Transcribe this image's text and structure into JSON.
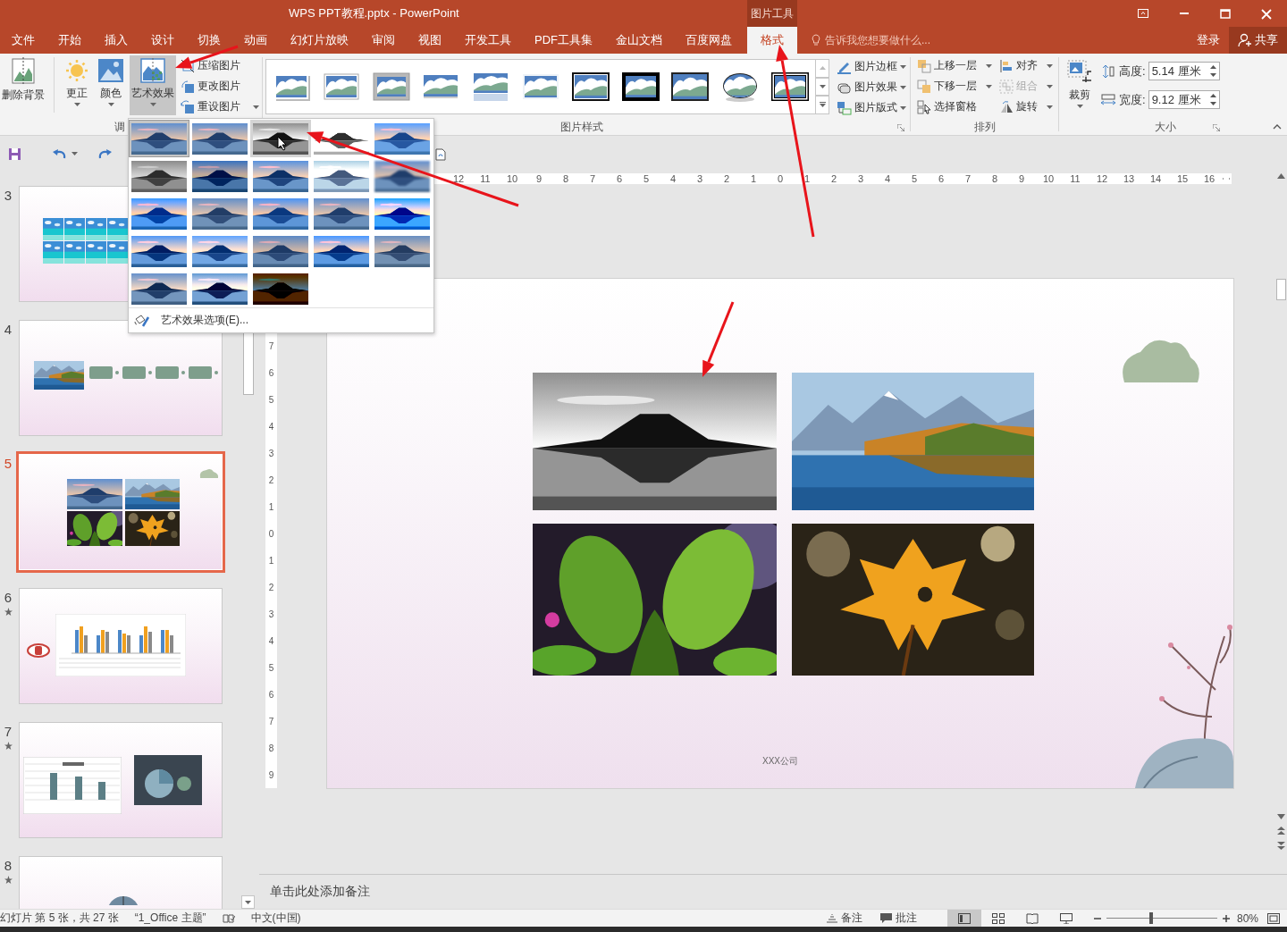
{
  "window": {
    "title": "WPS PPT教程.pptx - PowerPoint",
    "context_tab": "图片工具"
  },
  "menu_tabs": [
    {
      "label": "文件",
      "selected": false
    },
    {
      "label": "开始",
      "selected": false
    },
    {
      "label": "插入",
      "selected": false
    },
    {
      "label": "设计",
      "selected": false
    },
    {
      "label": "切换",
      "selected": false
    },
    {
      "label": "动画",
      "selected": false
    },
    {
      "label": "幻灯片放映",
      "selected": false
    },
    {
      "label": "审阅",
      "selected": false
    },
    {
      "label": "视图",
      "selected": false
    },
    {
      "label": "开发工具",
      "selected": false
    },
    {
      "label": "PDF工具集",
      "selected": false
    },
    {
      "label": "金山文档",
      "selected": false
    },
    {
      "label": "百度网盘",
      "selected": false
    },
    {
      "label": "格式",
      "selected": true
    }
  ],
  "tell_me": {
    "placeholder": "告诉我您想要做什么..."
  },
  "account": {
    "sign_in": "登录",
    "share": "共享"
  },
  "ribbon": {
    "adjust": {
      "remove_background": "删除背景",
      "buttons": [
        {
          "label": "更正",
          "selected": false,
          "kind": "corrections"
        },
        {
          "label": "颜色",
          "selected": false,
          "kind": "color"
        },
        {
          "label": "艺术效果",
          "selected": true,
          "kind": "artistic"
        }
      ],
      "commands": [
        "压缩图片",
        "更改图片",
        "重设图片"
      ],
      "group_label": "调"
    },
    "styles": {
      "items": [
        {
          "kind": "shadow"
        },
        {
          "kind": "frame"
        },
        {
          "kind": "gray-frame"
        },
        {
          "kind": "soft"
        },
        {
          "kind": "reflect"
        },
        {
          "kind": "soft-edge"
        },
        {
          "kind": "black-frame"
        },
        {
          "kind": "black-thick"
        },
        {
          "kind": "dark-frame"
        },
        {
          "kind": "oval"
        },
        {
          "kind": "double-frame"
        }
      ],
      "group_label": "图片样式"
    },
    "picture_format": [
      "图片边框",
      "图片效果",
      "图片版式"
    ],
    "arrange": {
      "items": [
        {
          "label": "上移一层",
          "disabled": false
        },
        {
          "label": "下移一层",
          "disabled": false
        },
        {
          "label": "选择窗格",
          "disabled": false
        },
        {
          "label": "对齐",
          "disabled": false
        },
        {
          "label": "组合",
          "disabled": true
        },
        {
          "label": "旋转",
          "disabled": false
        }
      ],
      "group_label": "排列"
    },
    "size": {
      "crop": "裁剪",
      "height_label": "高度:",
      "height": "5.14 厘米",
      "width_label": "宽度:",
      "width": "9.12 厘米",
      "group_label": "大小"
    }
  },
  "art_effects_menu": {
    "effects": [
      {
        "selected": true,
        "hovered": false
      },
      {
        "selected": false,
        "hovered": false
      },
      {
        "selected": false,
        "hovered": true
      },
      {
        "selected": false,
        "hovered": false
      },
      {
        "selected": false,
        "hovered": false
      },
      {
        "selected": false,
        "hovered": false
      },
      {
        "selected": false,
        "hovered": false
      },
      {
        "selected": false,
        "hovered": false
      },
      {
        "selected": false,
        "hovered": false
      },
      {
        "selected": false,
        "hovered": false
      },
      {
        "selected": false,
        "hovered": false
      },
      {
        "selected": false,
        "hovered": false
      },
      {
        "selected": false,
        "hovered": false
      },
      {
        "selected": false,
        "hovered": false
      },
      {
        "selected": false,
        "hovered": false
      },
      {
        "selected": false,
        "hovered": false
      },
      {
        "selected": false,
        "hovered": false
      },
      {
        "selected": false,
        "hovered": false
      },
      {
        "selected": false,
        "hovered": false
      },
      {
        "selected": false,
        "hovered": false
      },
      {
        "selected": false,
        "hovered": false
      },
      {
        "selected": false,
        "hovered": false
      },
      {
        "selected": false,
        "hovered": false
      }
    ],
    "options": "艺术效果选项(E)..."
  },
  "slides": [
    {
      "number": "3",
      "kind": "photo-grid",
      "selected": false,
      "animated": false
    },
    {
      "number": "4",
      "kind": "process",
      "selected": false,
      "animated": false
    },
    {
      "number": "5",
      "kind": "four-photos",
      "selected": true,
      "animated": false
    },
    {
      "number": "6",
      "kind": "chart",
      "selected": false,
      "animated": true
    },
    {
      "number": "7",
      "kind": "chart-pie",
      "selected": false,
      "animated": true
    },
    {
      "number": "8",
      "kind": "title-pie",
      "selected": false,
      "animated": true
    }
  ],
  "ruler": {
    "horizontal": [
      "12",
      "11",
      "10",
      "9",
      "8",
      "7",
      "6",
      "5",
      "4",
      "3",
      "2",
      "1",
      "0",
      "1",
      "2",
      "3",
      "4",
      "5",
      "6",
      "7",
      "8",
      "9",
      "10",
      "11",
      "12",
      "13",
      "14",
      "15",
      "16"
    ],
    "vertical": [
      "7",
      "6",
      "5",
      "4",
      "3",
      "2",
      "1",
      "0",
      "1",
      "2",
      "3",
      "4",
      "5",
      "6",
      "7",
      "8",
      "9"
    ]
  },
  "slide": {
    "footer": "XXX公司"
  },
  "notes": {
    "placeholder": "单击此处添加备注"
  },
  "status_bar": {
    "slide_info": "幻灯片 第 5 张，共 27 张",
    "theme": "“1_Office 主题”",
    "language": "中文(中国)",
    "notes": "备注",
    "comments": "批注",
    "views": [
      {
        "kind": "normal",
        "selected": true
      },
      {
        "kind": "sorter",
        "selected": false
      },
      {
        "kind": "reading",
        "selected": false
      },
      {
        "kind": "show",
        "selected": false
      }
    ],
    "zoom_slider": {
      "level": 0.4
    },
    "zoom": "80%"
  }
}
